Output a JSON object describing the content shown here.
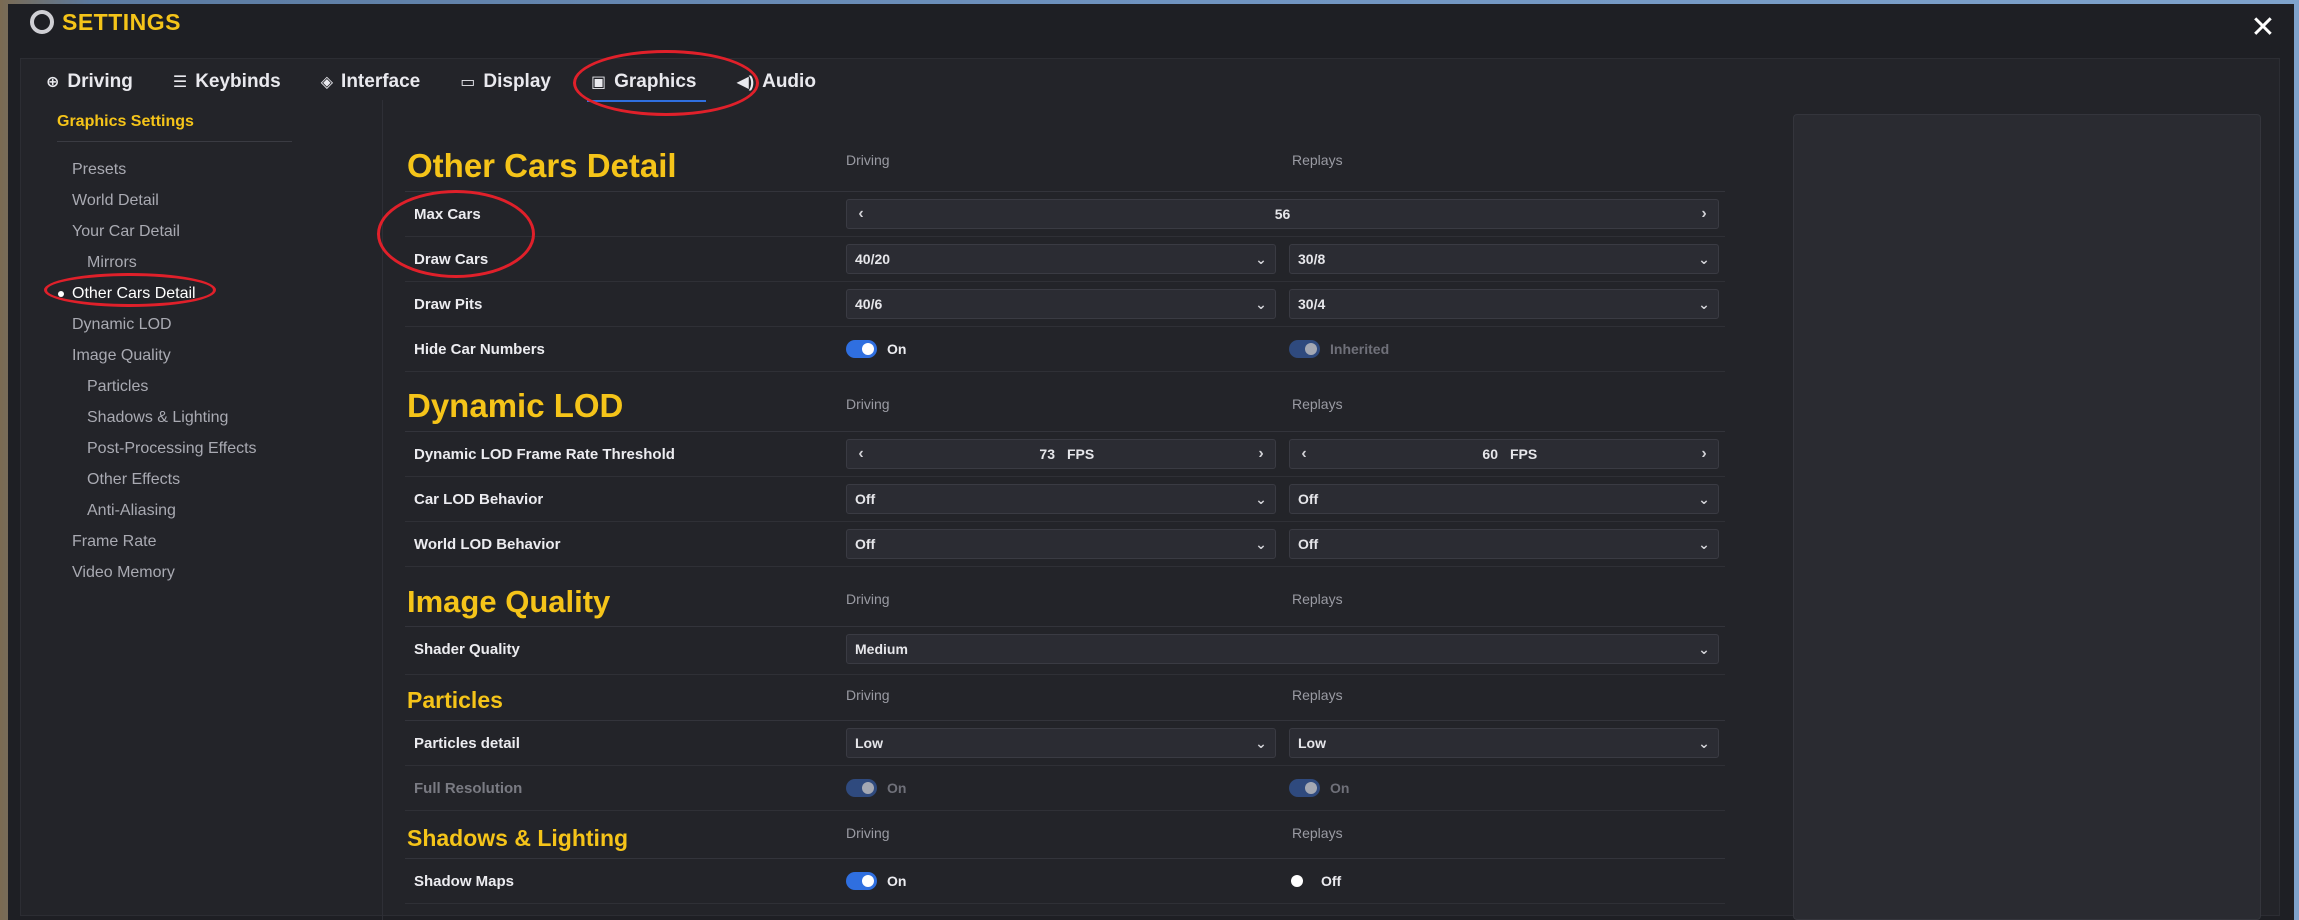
{
  "window": {
    "title": "SETTINGS",
    "close_label": "✕"
  },
  "tabs": [
    {
      "label": "Driving",
      "icon": "steering-wheel-icon"
    },
    {
      "label": "Keybinds",
      "icon": "sliders-icon"
    },
    {
      "label": "Interface",
      "icon": "layers-icon"
    },
    {
      "label": "Display",
      "icon": "monitor-icon"
    },
    {
      "label": "Graphics",
      "icon": "chip-icon",
      "active": true
    },
    {
      "label": "Audio",
      "icon": "speaker-icon"
    }
  ],
  "sidebar": {
    "heading": "Graphics Settings",
    "items": [
      {
        "label": "Presets"
      },
      {
        "label": "World Detail"
      },
      {
        "label": "Your Car Detail"
      },
      {
        "label": "Mirrors",
        "sub": true
      },
      {
        "label": "Other Cars Detail",
        "active": true
      },
      {
        "label": "Dynamic LOD"
      },
      {
        "label": "Image Quality"
      },
      {
        "label": "Particles",
        "sub": true
      },
      {
        "label": "Shadows & Lighting",
        "sub": true
      },
      {
        "label": "Post-Processing Effects",
        "sub": true
      },
      {
        "label": "Other Effects",
        "sub": true
      },
      {
        "label": "Anti-Aliasing",
        "sub": true
      },
      {
        "label": "Frame Rate"
      },
      {
        "label": "Video Memory"
      }
    ]
  },
  "columns": {
    "driving": "Driving",
    "replays": "Replays"
  },
  "sections": {
    "other_cars": {
      "title": "Other Cars Detail",
      "max_cars": {
        "label": "Max Cars",
        "value": "56",
        "prev": "‹",
        "next": "›"
      },
      "draw_cars": {
        "label": "Draw Cars",
        "driving": "40/20",
        "replays": "30/8"
      },
      "draw_pits": {
        "label": "Draw Pits",
        "driving": "40/6",
        "replays": "30/4"
      },
      "hide_numbers": {
        "label": "Hide Car Numbers",
        "driving": "On",
        "replays": "Inherited"
      }
    },
    "dynamic_lod": {
      "title": "Dynamic LOD",
      "threshold": {
        "label": "Dynamic LOD Frame Rate Threshold",
        "driving": "73",
        "replays": "60",
        "unit": "FPS",
        "prev": "‹",
        "next": "›"
      },
      "car_lod": {
        "label": "Car LOD Behavior",
        "driving": "Off",
        "replays": "Off"
      },
      "world_lod": {
        "label": "World LOD Behavior",
        "driving": "Off",
        "replays": "Off"
      }
    },
    "image_quality": {
      "title": "Image Quality",
      "shader": {
        "label": "Shader Quality",
        "value": "Medium"
      }
    },
    "particles": {
      "title": "Particles",
      "detail": {
        "label": "Particles detail",
        "driving": "Low",
        "replays": "Low"
      },
      "full_res": {
        "label": "Full Resolution",
        "driving": "On",
        "replays": "On"
      }
    },
    "shadows": {
      "title": "Shadows & Lighting",
      "shadow_maps": {
        "label": "Shadow Maps",
        "driving": "On",
        "replays": "Off"
      }
    }
  },
  "colors": {
    "accent": "#f5c419",
    "toggle": "#2f6fe0",
    "highlight_ring": "#e0202a"
  }
}
